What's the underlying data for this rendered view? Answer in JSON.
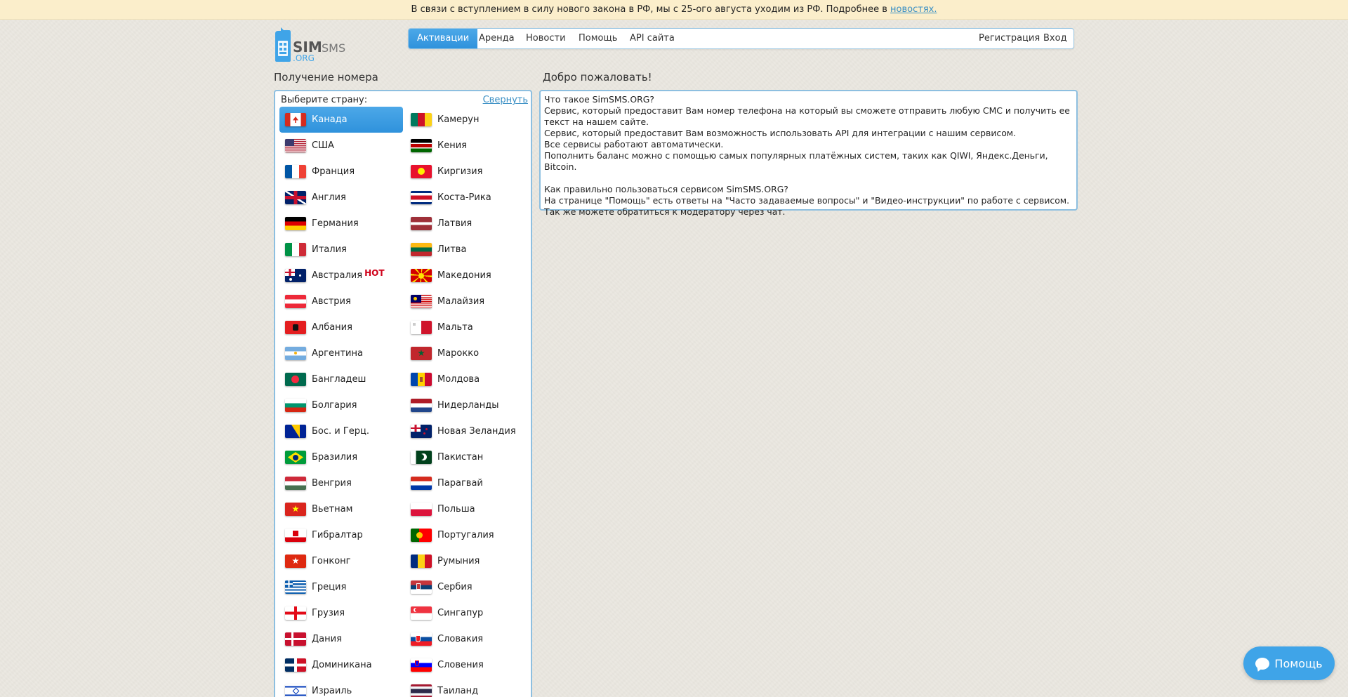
{
  "banner": {
    "text": "В связи с вступлением в силу нового закона в РФ, мы с 25-ого августа уходим из РФ. Подробнее в ",
    "link": "новостях."
  },
  "logo": {
    "sim": "SIM",
    "sms": "SMS",
    "org": ".ORG"
  },
  "nav": {
    "items": [
      "Активации",
      "Аренда",
      "Новости",
      "Помощь",
      "API сайта"
    ],
    "register": "Регистрация",
    "login": "Вход"
  },
  "countries_title": "Получение номера",
  "welcome_title": "Добро пожаловать!",
  "countries": {
    "choose_label": "Выберите страну:",
    "collapse_label": "Свернуть",
    "hot_label": "HOT",
    "left": [
      "Канада",
      "США",
      "Франция",
      "Англия",
      "Германия",
      "Италия",
      "Австралия",
      "Австрия",
      "Албания",
      "Аргентина",
      "Бангладеш",
      "Болгария",
      "Бос. и Герц.",
      "Бразилия",
      "Венгрия",
      "Вьетнам",
      "Гибралтар",
      "Гонконг",
      "Греция",
      "Грузия",
      "Дания",
      "Доминикана",
      "Израиль"
    ],
    "right": [
      "Камерун",
      "Кения",
      "Киргизия",
      "Коста-Рика",
      "Латвия",
      "Литва",
      "Македония",
      "Малайзия",
      "Мальта",
      "Марокко",
      "Молдова",
      "Нидерланды",
      "Новая Зеландия",
      "Пакистан",
      "Парагвай",
      "Польша",
      "Португалия",
      "Румыния",
      "Сербия",
      "Сингапур",
      "Словакия",
      "Словения",
      "Таиланд"
    ]
  },
  "welcome": {
    "q1": "Что такое SimSMS.ORG?",
    "l1": "Сервис, который предоставит Вам номер телефона на который вы сможете отправить любую СМС и получить ее текст на нашем сайте.",
    "l2": "Сервис, который предоставит Вам возможность использовать API для интеграции с нашим сервисом.",
    "l3": "Все сервисы работают автоматически.",
    "l4": "Пополнить баланс можно с помощью самых популярных платёжных систем, таких как QIWI, Яндекс.Деньги, Bitcoin.",
    "q2": "Как правильно пользоваться сервисом SimSMS.ORG?",
    "l5": "На странице \"Помощь\" есть ответы на \"Часто задаваемые вопросы\" и \"Видео-инструкции\" по работе с сервисом.",
    "l6": "Так же можете обратиться к модератору через чат."
  },
  "help_button": "Помощь",
  "colors": {
    "accent": "#3fa4e8",
    "banner_bg": "#fbeecb",
    "border": "#8dbfe0",
    "hot": "#d0021b"
  }
}
